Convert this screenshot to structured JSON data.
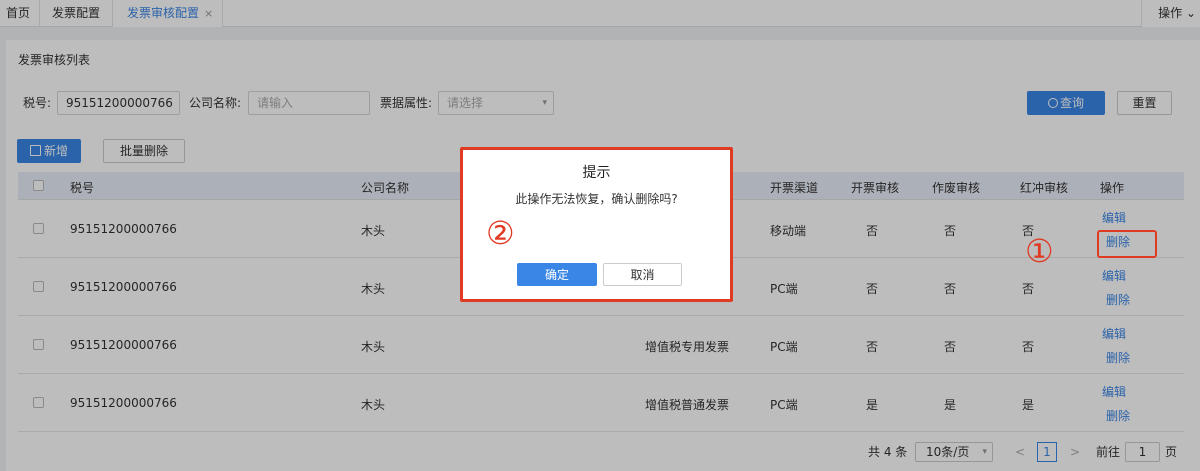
{
  "tabs": [
    {
      "label": "首页"
    },
    {
      "label": "发票配置"
    },
    {
      "label": "发票审核配置",
      "close": "×"
    }
  ],
  "tab_operation": "操作 ⌄",
  "panel_title": "发票审核列表",
  "search": {
    "tax_label": "税号:",
    "tax_value": "95151200000766",
    "company_label": "公司名称:",
    "company_placeholder": "请输入",
    "attr_label": "票据属性:",
    "attr_placeholder": "请选择",
    "query_label": "查询",
    "reset_label": "重置"
  },
  "toolbar": {
    "add_label": "新增",
    "batch_delete_label": "批量删除"
  },
  "table": {
    "headers": [
      "税号",
      "公司名称",
      "",
      "开票渠道",
      "开票审核",
      "作废审核",
      "红冲审核",
      "操作"
    ],
    "rows": [
      {
        "tax": "95151200000766",
        "company": "木头",
        "type": "",
        "channel": "移动端",
        "invoice": "否",
        "void": "否",
        "redflush": "否"
      },
      {
        "tax": "95151200000766",
        "company": "木头",
        "type": "",
        "channel": "PC端",
        "invoice": "否",
        "void": "否",
        "redflush": "否"
      },
      {
        "tax": "95151200000766",
        "company": "木头",
        "type": "增值税专用发票",
        "channel": "PC端",
        "invoice": "否",
        "void": "否",
        "redflush": "否"
      },
      {
        "tax": "95151200000766",
        "company": "木头",
        "type": "增值税普通发票",
        "channel": "PC端",
        "invoice": "是",
        "void": "是",
        "redflush": "是"
      }
    ],
    "edit_label": "编辑",
    "delete_label": "删除"
  },
  "pagination": {
    "total": "共 4 条",
    "page_size": "10条/页",
    "current_page": "1",
    "goto_label": "前往",
    "goto_value": "1",
    "page_suffix": "页"
  },
  "dialog": {
    "title": "提示",
    "message": "此操作无法恢复，确认删除吗?",
    "confirm_label": "确定",
    "cancel_label": "取消"
  },
  "annotations": {
    "marker_1": "①",
    "marker_2": "②"
  },
  "colors": {
    "primary": "#3a86e6",
    "annotation_red": "#e03a23"
  }
}
